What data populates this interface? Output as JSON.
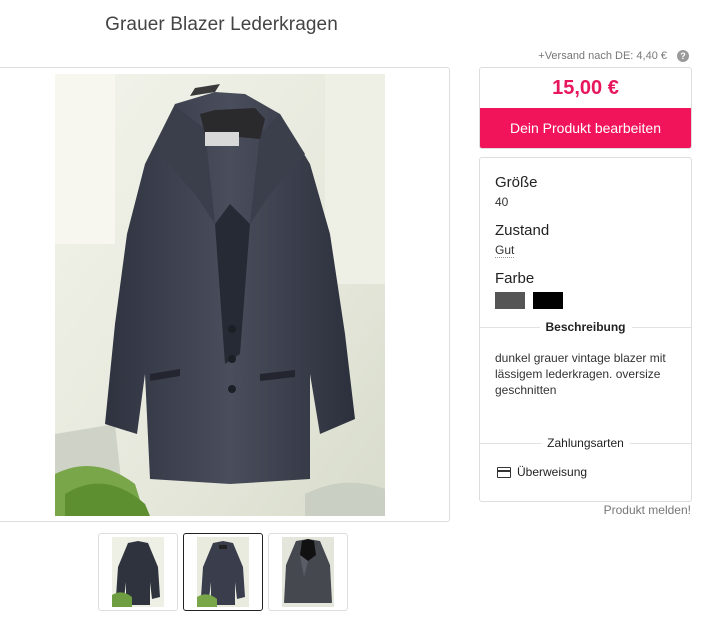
{
  "product": {
    "title": "Grauer Blazer Lederkragen",
    "shipping": "+Versand nach DE: 4,40 €",
    "help_icon": "question-mark-icon",
    "price": "15,00 €",
    "edit_button": "Dein Produkt bearbeiten",
    "accent_color": "#f2145b"
  },
  "details": {
    "size_label": "Größe",
    "size_value": "40",
    "condition_label": "Zustand",
    "condition_value": "Gut",
    "color_label": "Farbe",
    "colors": [
      "#555555",
      "#000000"
    ],
    "description_label": "Beschreibung",
    "description": "dunkel grauer vintage blazer mit lässigem lederkragen. oversize geschnitten",
    "payment_label": "Zahlungsarten",
    "payment_method": "Überweisung",
    "payment_icon": "credit-card-icon"
  },
  "report_link": "Produkt melden!",
  "gallery": {
    "thumbnail_count": 3,
    "active_thumbnail": 2
  }
}
